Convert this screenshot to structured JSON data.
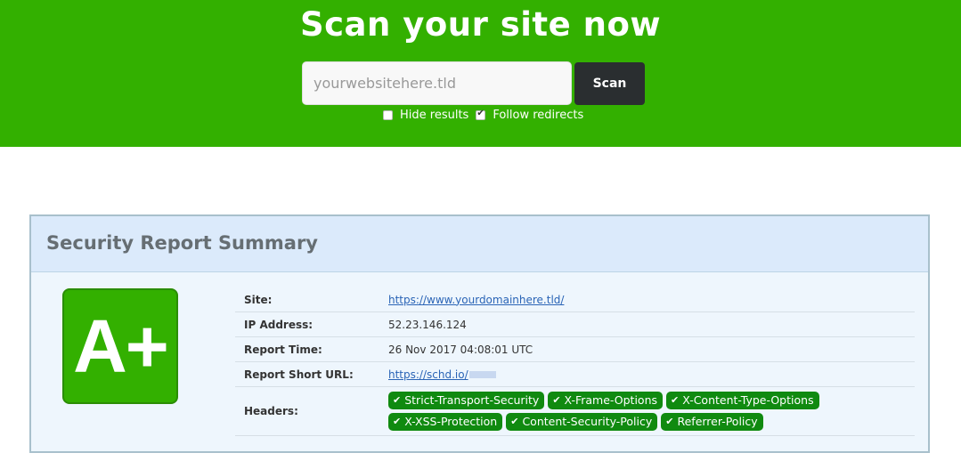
{
  "hero": {
    "title": "Scan your site now",
    "input_placeholder": "yourwebsitehere.tld",
    "scan_label": "Scan",
    "options": [
      {
        "label": "Hide results",
        "checked": false
      },
      {
        "label": "Follow redirects",
        "checked": true
      }
    ]
  },
  "report": {
    "title": "Security Report Summary",
    "grade": "A+",
    "rows": {
      "site": {
        "label": "Site:",
        "value": "https://www.yourdomainhere.tld/"
      },
      "ip": {
        "label": "IP Address:",
        "value": "52.23.146.124"
      },
      "time": {
        "label": "Report Time:",
        "value": "26 Nov 2017 04:08:01 UTC"
      },
      "short_url": {
        "label": "Report Short URL:",
        "value": "https://schd.io/"
      },
      "headers": {
        "label": "Headers:"
      }
    },
    "headers": [
      "Strict-Transport-Security",
      "X-Frame-Options",
      "X-Content-Type-Options",
      "X-XSS-Protection",
      "Content-Security-Policy",
      "Referrer-Policy"
    ],
    "badge_icon": "check-icon"
  },
  "colors": {
    "brand_green": "#33b000",
    "badge_green": "#108a10",
    "button_dark": "#2a2e30"
  }
}
